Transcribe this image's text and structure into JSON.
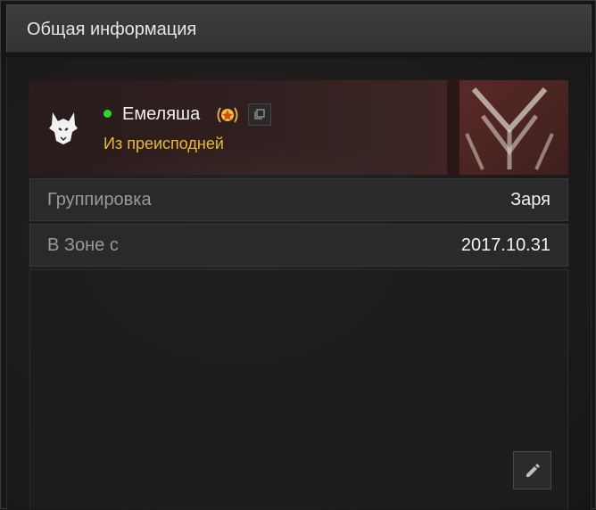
{
  "panel": {
    "title": "Общая информация"
  },
  "profile": {
    "name": "Емеляша",
    "status": "Из преисподней",
    "online": true,
    "faction_icon": "wolf-head-icon",
    "rank_icon": "laurel-star-icon",
    "copy_icon": "copy-icon"
  },
  "rows": [
    {
      "label": "Группировка",
      "value": "Заря"
    },
    {
      "label": "В Зоне с",
      "value": "2017.10.31"
    }
  ],
  "about": {
    "edit_icon": "pencil-icon"
  },
  "colors": {
    "online": "#2fd52f",
    "status_text": "#e8b93c",
    "header_bg": "#383838"
  }
}
